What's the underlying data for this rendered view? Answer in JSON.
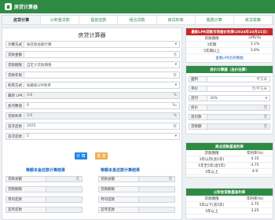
{
  "app": {
    "title": "房贷计算器"
  },
  "tabs": [
    "房贷计算",
    "公积金贷款",
    "提前还款",
    "组合贷款",
    "房贷利率",
    "税费计算",
    "房贷政策"
  ],
  "calc": {
    "title": "房贷计算器",
    "rows": [
      {
        "label": "计算方式",
        "value": "按贷款总额计算",
        "kind": "select"
      },
      {
        "label": "贷款金额",
        "value": "",
        "unit": "元"
      },
      {
        "label": "贷款期限",
        "value": "自定义贷款期限",
        "kind": "select"
      },
      {
        "label": "贷款年限",
        "value": "",
        "unit": "年"
      },
      {
        "label": "利率方式",
        "value": "按最新LPR利率",
        "kind": "select"
      },
      {
        "label": "最新 LPR",
        "value": "3.6",
        "unit": "%",
        "readonly": true
      },
      {
        "label": "加点数值",
        "value": "0",
        "unit": "‰"
      },
      {
        "label": "贷款利率",
        "value": "3.6",
        "unit": "%",
        "readonly": true
      },
      {
        "label": "首次还款",
        "value": "2025",
        "unit": "年"
      },
      {
        "label": "首次还款",
        "value": "5",
        "kind": "select"
      }
    ],
    "calc_button": "计 算",
    "reset_button": "重 置",
    "result_left_title": "等额本金还款计算结果",
    "result_right_title": "等额本息还款计算结果",
    "result_rows": [
      {
        "label": "贷款总额",
        "unit": "元"
      },
      {
        "label": "贷款期限",
        "unit": ""
      },
      {
        "label": "月均还款",
        "unit": ""
      },
      {
        "label": "首月还款",
        "unit": ""
      }
    ]
  },
  "lpr_card": {
    "title": "最新LPR贷款市场报价利率(2024年10月21日)",
    "col1": "贷款期限",
    "col2": "LPR(%)",
    "rows": [
      {
        "term": "1年期",
        "rate": "3.1%"
      },
      {
        "term": "5年期以上",
        "rate": "3.6%"
      }
    ],
    "link": "查看LPR历史数据"
  },
  "house_card": {
    "title": "房价计算器（总价估算）",
    "rows": [
      {
        "label": "面积",
        "unit": "平方米"
      },
      {
        "label": "单价",
        "unit": "元/平方米"
      },
      {
        "label": "首付",
        "value": "30%"
      },
      {
        "label": "房价",
        "unit": "元"
      },
      {
        "label": "首付款",
        "unit": "元"
      },
      {
        "label": "贷款额",
        "unit": "元"
      }
    ]
  },
  "commercial_card": {
    "title": "商业贷款基准利率",
    "col1": "贷款期限",
    "col2": "年利率(%)",
    "rows": [
      {
        "term": "1年以内(含1年)",
        "rate": "4.35"
      },
      {
        "term": "1年至5年(含5年)",
        "rate": "4.75"
      },
      {
        "term": "5年以上",
        "rate": "4.9"
      }
    ]
  },
  "fund_card": {
    "title": "公积金贷款基准利率",
    "col1": "贷款期限",
    "col2": "年利率(%)",
    "rows": [
      {
        "term": "5年以下(含5年)",
        "rate": "2.75"
      },
      {
        "term": "5年以上",
        "rate": "3.25"
      }
    ]
  }
}
